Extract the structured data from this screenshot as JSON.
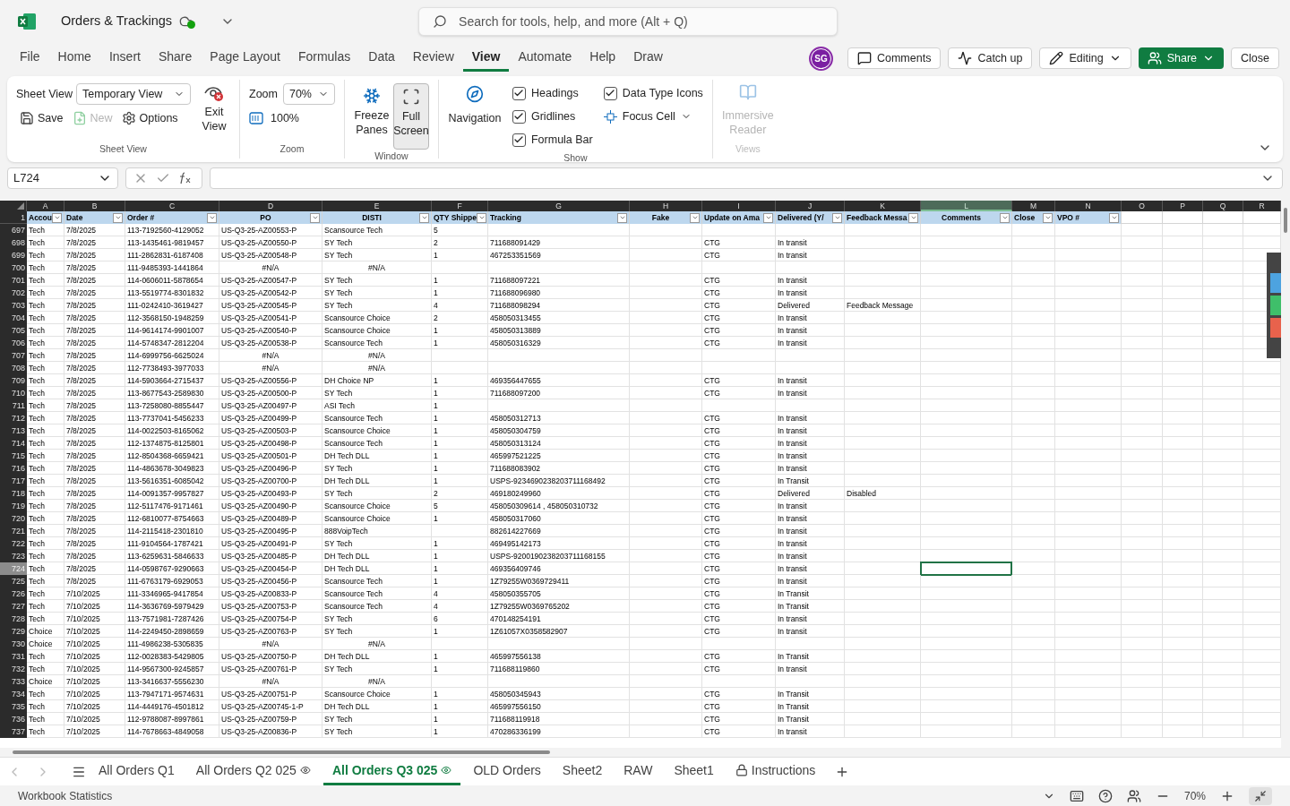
{
  "title_bar": {
    "document_title": "Orders & Trackings",
    "search": {
      "placeholder": "Search for tools, help, and more (Alt + Q)"
    }
  },
  "menu_tabs": [
    {
      "label": "File",
      "selected": false
    },
    {
      "label": "Home",
      "selected": false
    },
    {
      "label": "Insert",
      "selected": false
    },
    {
      "label": "Share",
      "selected": false
    },
    {
      "label": "Page Layout",
      "selected": false
    },
    {
      "label": "Formulas",
      "selected": false
    },
    {
      "label": "Data",
      "selected": false
    },
    {
      "label": "Review",
      "selected": false
    },
    {
      "label": "View",
      "selected": true
    },
    {
      "label": "Automate",
      "selected": false
    },
    {
      "label": "Help",
      "selected": false
    },
    {
      "label": "Draw",
      "selected": false
    }
  ],
  "user": {
    "initials": "SG"
  },
  "actions": [
    {
      "label": "Comments",
      "kind": "comments"
    },
    {
      "label": "Catch up",
      "kind": "catchup"
    },
    {
      "label": "Editing",
      "kind": "editing"
    },
    {
      "label": "Share",
      "kind": "share"
    },
    {
      "label": "Close",
      "kind": "close"
    }
  ],
  "ribbon": {
    "groups": [
      {
        "kind": "sheet_view",
        "label": "Sheet View",
        "field_label": "Sheet View",
        "dropdown": "Temporary View",
        "buttons": [
          {
            "label": "Save",
            "disabled": false,
            "kind": "save"
          },
          {
            "label": "New",
            "disabled": true,
            "kind": "new"
          },
          {
            "label": "Options",
            "disabled": false,
            "kind": "options"
          }
        ],
        "exit": "Exit View"
      },
      {
        "kind": "zoom",
        "label": "Zoom",
        "field_label": "Zoom",
        "dropdown": "70%",
        "button": "100%"
      },
      {
        "kind": "window",
        "label": "Window",
        "buttons": [
          {
            "label": "Freeze Panes",
            "pressed": false,
            "kind": "freeze"
          },
          {
            "label": "Full Screen",
            "pressed": true,
            "kind": "fullscreen"
          }
        ]
      },
      {
        "kind": "show",
        "label": "Show",
        "navigation": "Navigation",
        "items": [
          {
            "kind": "checkbox",
            "label": "Headings",
            "checked": true
          },
          {
            "kind": "checkbox",
            "label": "Gridlines",
            "checked": true
          },
          {
            "kind": "checkbox",
            "label": "Formula Bar",
            "checked": true
          },
          {
            "kind": "checkbox",
            "label": "Data Type Icons",
            "checked": true
          },
          {
            "kind": "dropdown",
            "label": "Focus Cell"
          }
        ]
      },
      {
        "kind": "views",
        "label": "Views",
        "disabled": true,
        "button": "Immersive Reader"
      }
    ]
  },
  "formula_bar": {
    "name_box": "L724"
  },
  "sheet": {
    "header_row": "1",
    "columns": [
      {
        "letter": "A",
        "header": "Accou",
        "centered": false,
        "filter": true,
        "selected": false
      },
      {
        "letter": "B",
        "header": "Date",
        "centered": false,
        "filter": true,
        "selected": false
      },
      {
        "letter": "C",
        "header": "Order #",
        "centered": false,
        "filter": true,
        "selected": false
      },
      {
        "letter": "D",
        "header": "PO",
        "centered": true,
        "filter": true,
        "selected": false
      },
      {
        "letter": "E",
        "header": "DISTI",
        "centered": true,
        "filter": true,
        "selected": false
      },
      {
        "letter": "F",
        "header": "QTY Shippe",
        "centered": false,
        "filter": true,
        "selected": false
      },
      {
        "letter": "G",
        "header": "Tracking",
        "centered": false,
        "filter": true,
        "selected": false
      },
      {
        "letter": "H",
        "header": "Fake",
        "centered": true,
        "filter": true,
        "selected": false
      },
      {
        "letter": "I",
        "header": "Update on Ama",
        "centered": false,
        "filter": true,
        "selected": false
      },
      {
        "letter": "J",
        "header": "Delivered (Y/",
        "centered": false,
        "filter": true,
        "selected": false
      },
      {
        "letter": "K",
        "header": "Feedback Messa",
        "centered": false,
        "filter": true,
        "selected": false
      },
      {
        "letter": "L",
        "header": "Comments",
        "centered": true,
        "filter": true,
        "selected": true
      },
      {
        "letter": "M",
        "header": "Close",
        "centered": false,
        "filter": true,
        "selected": false
      },
      {
        "letter": "N",
        "header": "VPO #",
        "centered": false,
        "filter": true,
        "selected": false
      },
      {
        "letter": "O",
        "selected": false
      },
      {
        "letter": "P",
        "selected": false
      },
      {
        "letter": "Q",
        "selected": false
      },
      {
        "letter": "R",
        "selected": false
      }
    ],
    "rows": [
      {
        "number": "697",
        "selected": false,
        "lookup_error": false,
        "cells": {
          "A": "Tech",
          "B": "7/8/2025",
          "C": "113-7192560-4129052",
          "D": "US-Q3-25-AZ00553-P",
          "E": "Scansource Tech",
          "F": "5"
        }
      },
      {
        "number": "698",
        "selected": false,
        "lookup_error": false,
        "cells": {
          "A": "Tech",
          "B": "7/8/2025",
          "C": "113-1435461-9819457",
          "D": "US-Q3-25-AZ00550-P",
          "E": "SY Tech",
          "F": "2",
          "G": "711688091429",
          "I": "CTG",
          "J": "In transit"
        }
      },
      {
        "number": "699",
        "selected": false,
        "lookup_error": false,
        "cells": {
          "A": "Tech",
          "B": "7/8/2025",
          "C": "111-2862831-6187408",
          "D": "US-Q3-25-AZ00548-P",
          "E": "SY Tech",
          "F": "1",
          "G": "467253351569",
          "I": "CTG",
          "J": "In transit"
        }
      },
      {
        "number": "700",
        "selected": false,
        "lookup_error": true,
        "cells": {
          "A": "Tech",
          "B": "7/8/2025",
          "C": "111-9485393-1441864",
          "D": "#N/A",
          "E": "#N/A"
        }
      },
      {
        "number": "701",
        "selected": false,
        "lookup_error": false,
        "cells": {
          "A": "Tech",
          "B": "7/8/2025",
          "C": "114-0606011-5878654",
          "D": "US-Q3-25-AZ00547-P",
          "E": "SY Tech",
          "F": "1",
          "G": "711688097221",
          "I": "CTG",
          "J": "In transit"
        }
      },
      {
        "number": "702",
        "selected": false,
        "lookup_error": false,
        "cells": {
          "A": "Tech",
          "B": "7/8/2025",
          "C": "113-5519774-8301832",
          "D": "US-Q3-25-AZ00542-P",
          "E": "SY Tech",
          "F": "1",
          "G": "711688096980",
          "I": "CTG",
          "J": "In transit"
        }
      },
      {
        "number": "703",
        "selected": false,
        "lookup_error": false,
        "cells": {
          "A": "Tech",
          "B": "7/8/2025",
          "C": "111-0242410-3619427",
          "D": "US-Q3-25-AZ00545-P",
          "E": "SY Tech",
          "F": "4",
          "G": "711688098294",
          "I": "CTG",
          "J": "Delivered",
          "K": "Feedback Message"
        }
      },
      {
        "number": "704",
        "selected": false,
        "lookup_error": false,
        "cells": {
          "A": "Tech",
          "B": "7/8/2025",
          "C": "112-3568150-1948259",
          "D": "US-Q3-25-AZ00541-P",
          "E": "Scansource Choice",
          "F": "2",
          "G": "458050313455",
          "I": "CTG",
          "J": "In transit"
        }
      },
      {
        "number": "705",
        "selected": false,
        "lookup_error": false,
        "cells": {
          "A": "Tech",
          "B": "7/8/2025",
          "C": "114-9614174-9901007",
          "D": "US-Q3-25-AZ00540-P",
          "E": "Scansource Choice",
          "F": "1",
          "G": "458050313889",
          "I": "CTG",
          "J": "In transit"
        }
      },
      {
        "number": "706",
        "selected": false,
        "lookup_error": false,
        "cells": {
          "A": "Tech",
          "B": "7/8/2025",
          "C": "114-5748347-2812204",
          "D": "US-Q3-25-AZ00538-P",
          "E": "Scansource Tech",
          "F": "1",
          "G": "458050316329",
          "I": "CTG",
          "J": "In transit"
        }
      },
      {
        "number": "707",
        "selected": false,
        "lookup_error": true,
        "cells": {
          "A": "Tech",
          "B": "7/8/2025",
          "C": "114-6999756-6625024",
          "D": "#N/A",
          "E": "#N/A"
        }
      },
      {
        "number": "708",
        "selected": false,
        "lookup_error": true,
        "cells": {
          "A": "Tech",
          "B": "7/8/2025",
          "C": "112-7738493-3977033",
          "D": "#N/A",
          "E": "#N/A"
        }
      },
      {
        "number": "709",
        "selected": false,
        "lookup_error": false,
        "cells": {
          "A": "Tech",
          "B": "7/8/2025",
          "C": "114-5903664-2715437",
          "D": "US-Q3-25-AZ00556-P",
          "E": "DH Choice NP",
          "F": "1",
          "G": "469356447655",
          "I": "CTG",
          "J": "In transit"
        }
      },
      {
        "number": "710",
        "selected": false,
        "lookup_error": false,
        "cells": {
          "A": "Tech",
          "B": "7/8/2025",
          "C": "113-8677543-2589830",
          "D": "US-Q3-25-AZ00500-P",
          "E": "SY Tech",
          "F": "1",
          "G": "711688097200",
          "I": "CTG",
          "J": "In transit"
        }
      },
      {
        "number": "711",
        "selected": false,
        "lookup_error": false,
        "cells": {
          "A": "Tech",
          "B": "7/8/2025",
          "C": "113-7258080-8855447",
          "D": "US-Q3-25-AZ00497-P",
          "E": "ASI Tech",
          "F": "1"
        }
      },
      {
        "number": "712",
        "selected": false,
        "lookup_error": false,
        "cells": {
          "A": "Tech",
          "B": "7/8/2025",
          "C": "113-7737041-5456233",
          "D": "US-Q3-25-AZ00499-P",
          "E": "Scansource Tech",
          "F": "1",
          "G": "458050312713",
          "I": "CTG",
          "J": "In transit"
        }
      },
      {
        "number": "713",
        "selected": false,
        "lookup_error": false,
        "cells": {
          "A": "Tech",
          "B": "7/8/2025",
          "C": "114-0022503-8165062",
          "D": "US-Q3-25-AZ00503-P",
          "E": "Scansource Choice",
          "F": "1",
          "G": "458050304759",
          "I": "CTG",
          "J": "In transit"
        }
      },
      {
        "number": "714",
        "selected": false,
        "lookup_error": false,
        "cells": {
          "A": "Tech",
          "B": "7/8/2025",
          "C": "112-1374875-8125801",
          "D": "US-Q3-25-AZ00498-P",
          "E": "Scansource Tech",
          "F": "1",
          "G": "458050313124",
          "I": "CTG",
          "J": "In transit"
        }
      },
      {
        "number": "715",
        "selected": false,
        "lookup_error": false,
        "cells": {
          "A": "Tech",
          "B": "7/8/2025",
          "C": "112-8504368-6659421",
          "D": "US-Q3-25-AZ00501-P",
          "E": "DH Tech DLL",
          "F": "1",
          "G": "465997521225",
          "I": "CTG",
          "J": "In transit"
        }
      },
      {
        "number": "716",
        "selected": false,
        "lookup_error": false,
        "cells": {
          "A": "Tech",
          "B": "7/8/2025",
          "C": "114-4863678-3049823",
          "D": "US-Q3-25-AZ00496-P",
          "E": "SY Tech",
          "F": "1",
          "G": "711688083902",
          "I": "CTG",
          "J": "In transit"
        }
      },
      {
        "number": "717",
        "selected": false,
        "lookup_error": false,
        "cells": {
          "A": "Tech",
          "B": "7/8/2025",
          "C": "113-5616351-6085042",
          "D": "US-Q3-25-AZ00700-P",
          "E": "DH Tech DLL",
          "F": "1",
          "G": "USPS-9234690238203711168492",
          "I": "CTG",
          "J": "In Transit"
        }
      },
      {
        "number": "718",
        "selected": false,
        "lookup_error": false,
        "cells": {
          "A": "Tech",
          "B": "7/8/2025",
          "C": "114-0091357-9957827",
          "D": "US-Q3-25-AZ00493-P",
          "E": "SY Tech",
          "F": "2",
          "G": "469180249960",
          "I": "CTG",
          "J": "Delivered",
          "K": "Disabled"
        }
      },
      {
        "number": "719",
        "selected": false,
        "lookup_error": false,
        "cells": {
          "A": "Tech",
          "B": "7/8/2025",
          "C": "112-5117476-9171461",
          "D": "US-Q3-25-AZ00490-P",
          "E": "Scansource Choice",
          "F": "5",
          "G": "458050309614 , 458050310732",
          "I": "CTG",
          "J": "In transit"
        }
      },
      {
        "number": "720",
        "selected": false,
        "lookup_error": false,
        "cells": {
          "A": "Tech",
          "B": "7/8/2025",
          "C": "112-6810077-8754663",
          "D": "US-Q3-25-AZ00489-P",
          "E": "Scansource Choice",
          "F": "1",
          "G": "458050317060",
          "I": "CTG",
          "J": "In transit"
        }
      },
      {
        "number": "721",
        "selected": false,
        "lookup_error": false,
        "cells": {
          "A": "Tech",
          "B": "7/8/2025",
          "C": "114-2115418-2301810",
          "D": "US-Q3-25-AZ00495-P",
          "E": "888VoipTech",
          "G": "882614227669",
          "I": "CTG",
          "J": "In transit"
        }
      },
      {
        "number": "722",
        "selected": false,
        "lookup_error": false,
        "cells": {
          "A": "Tech",
          "B": "7/8/2025",
          "C": "111-9104564-1787421",
          "D": "US-Q3-25-AZ00491-P",
          "E": "SY Tech",
          "F": "1",
          "G": "469495142173",
          "I": "CTG",
          "J": "In transit"
        }
      },
      {
        "number": "723",
        "selected": false,
        "lookup_error": false,
        "cells": {
          "A": "Tech",
          "B": "7/8/2025",
          "C": "113-6259631-5846633",
          "D": "US-Q3-25-AZ00485-P",
          "E": "DH Tech DLL",
          "F": "1",
          "G": "USPS-9200190238203711168155",
          "I": "CTG",
          "J": "In transit"
        }
      },
      {
        "number": "724",
        "selected": true,
        "lookup_error": false,
        "cells": {
          "A": "Tech",
          "B": "7/8/2025",
          "C": "114-0598767-9290663",
          "D": "US-Q3-25-AZ00454-P",
          "E": "DH Tech DLL",
          "F": "1",
          "G": "469356409746",
          "I": "CTG",
          "J": "In transit"
        }
      },
      {
        "number": "725",
        "selected": false,
        "lookup_error": false,
        "cells": {
          "A": "Tech",
          "B": "7/8/2025",
          "C": "111-6763179-6929053",
          "D": "US-Q3-25-AZ00456-P",
          "E": "Scansource Tech",
          "F": "1",
          "G": "1Z79255W0369729411",
          "I": "CTG",
          "J": "In transit"
        }
      },
      {
        "number": "726",
        "selected": false,
        "lookup_error": false,
        "cells": {
          "A": "Tech",
          "B": "7/10/2025",
          "C": "111-3346965-9417854",
          "D": "US-Q3-25-AZ00833-P",
          "E": "Scansource Tech",
          "F": "4",
          "G": "458050355705",
          "I": "CTG",
          "J": "In Transit"
        }
      },
      {
        "number": "727",
        "selected": false,
        "lookup_error": false,
        "cells": {
          "A": "Tech",
          "B": "7/10/2025",
          "C": "114-3636769-5979429",
          "D": "US-Q3-25-AZ00753-P",
          "E": "Scansource Tech",
          "F": "4",
          "G": "1Z79255W0369765202",
          "I": "CTG",
          "J": "In Transit"
        }
      },
      {
        "number": "728",
        "selected": false,
        "lookup_error": false,
        "cells": {
          "A": "Tech",
          "B": "7/10/2025",
          "C": "113-7571981-7287426",
          "D": "US-Q3-25-AZ00754-P",
          "E": "SY Tech",
          "F": "6",
          "G": "470148254191",
          "I": "CTG",
          "J": "In transit"
        }
      },
      {
        "number": "729",
        "selected": false,
        "lookup_error": false,
        "cells": {
          "A": "Choice",
          "B": "7/10/2025",
          "C": "114-2249450-2898659",
          "D": "US-Q3-25-AZ00763-P",
          "E": "SY Tech",
          "F": "1",
          "G": "1Z61057X0358582907",
          "I": "CTG",
          "J": "In transit"
        }
      },
      {
        "number": "730",
        "selected": false,
        "lookup_error": true,
        "cells": {
          "A": "Choice",
          "B": "7/10/2025",
          "C": "111-4986238-5305835",
          "D": "#N/A",
          "E": "#N/A"
        }
      },
      {
        "number": "731",
        "selected": false,
        "lookup_error": false,
        "cells": {
          "A": "Tech",
          "B": "7/10/2025",
          "C": "112-0028383-5429805",
          "D": "US-Q3-25-AZ00750-P",
          "E": "DH Tech DLL",
          "F": "1",
          "G": "465997556138",
          "I": "CTG",
          "J": "In Transit"
        }
      },
      {
        "number": "732",
        "selected": false,
        "lookup_error": false,
        "cells": {
          "A": "Tech",
          "B": "7/10/2025",
          "C": "114-9567300-9245857",
          "D": "US-Q3-25-AZ00761-P",
          "E": "SY Tech",
          "F": "1",
          "G": "711688119860",
          "I": "CTG",
          "J": "In transit"
        }
      },
      {
        "number": "733",
        "selected": false,
        "lookup_error": true,
        "cells": {
          "A": "Choice",
          "B": "7/10/2025",
          "C": "113-3416637-5556230",
          "D": "#N/A",
          "E": "#N/A"
        }
      },
      {
        "number": "734",
        "selected": false,
        "lookup_error": false,
        "cells": {
          "A": "Tech",
          "B": "7/10/2025",
          "C": "113-7947171-9574631",
          "D": "US-Q3-25-AZ00751-P",
          "E": "Scansource Choice",
          "F": "1",
          "G": "458050345943",
          "I": "CTG",
          "J": "In Transit"
        }
      },
      {
        "number": "735",
        "selected": false,
        "lookup_error": false,
        "cells": {
          "A": "Tech",
          "B": "7/10/2025",
          "C": "114-4449176-4501812",
          "D": "US-Q3-25-AZ00745-1-P",
          "E": "DH Tech DLL",
          "F": "1",
          "G": "465997556150",
          "I": "CTG",
          "J": "In Transit"
        }
      },
      {
        "number": "736",
        "selected": false,
        "lookup_error": false,
        "cells": {
          "A": "Tech",
          "B": "7/10/2025",
          "C": "112-9788087-8997861",
          "D": "US-Q3-25-AZ00759-P",
          "E": "SY Tech",
          "F": "1",
          "G": "711688119918",
          "I": "CTG",
          "J": "In Transit"
        }
      },
      {
        "number": "737",
        "selected": false,
        "lookup_error": false,
        "cells": {
          "A": "Tech",
          "B": "7/10/2025",
          "C": "114-7678663-4849058",
          "D": "US-Q3-25-AZ00836-P",
          "E": "SY Tech",
          "F": "1",
          "G": "470286336199",
          "I": "CTG",
          "J": "In transit"
        }
      }
    ]
  },
  "sheet_tabs": [
    {
      "label": "All Orders Q1",
      "selected": false,
      "kind": "plain"
    },
    {
      "label": "All Orders Q2 025",
      "selected": false,
      "kind": "view"
    },
    {
      "label": "All Orders Q3 025",
      "selected": true,
      "kind": "view"
    },
    {
      "label": "OLD Orders",
      "selected": false,
      "kind": "plain"
    },
    {
      "label": "Sheet2",
      "selected": false,
      "kind": "plain"
    },
    {
      "label": "RAW",
      "selected": false,
      "kind": "plain"
    },
    {
      "label": "Sheet1",
      "selected": false,
      "kind": "plain"
    },
    {
      "label": "Instructions",
      "selected": false,
      "kind": "locked"
    }
  ],
  "status_bar": {
    "left": "Workbook Statistics",
    "zoom": "70%"
  }
}
